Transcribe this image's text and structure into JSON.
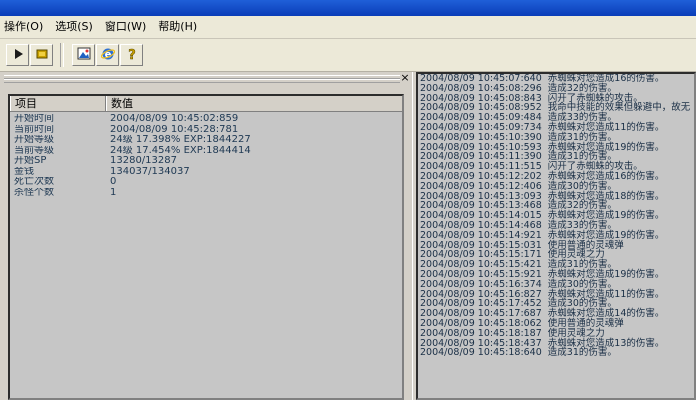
{
  "menu": [
    {
      "label": "操作(O)"
    },
    {
      "label": "选项(S)"
    },
    {
      "label": "窗口(W)"
    },
    {
      "label": "帮助(H)"
    }
  ],
  "toolbar_icons": [
    "play-icon",
    "stop-icon",
    "image-icon",
    "ie-icon",
    "help-icon"
  ],
  "panel": {
    "close_label": "×"
  },
  "stats": {
    "columns": [
      "项目",
      "数值"
    ],
    "rows": [
      {
        "name": "开始时间",
        "value": "2004/08/09 10:45:02:859"
      },
      {
        "name": "当前时间",
        "value": "2004/08/09 10:45:28:781"
      },
      {
        "name": "开始等级",
        "value": "24级 17.398% EXP:1844227"
      },
      {
        "name": "当前等级",
        "value": "24级 17.454% EXP:1844414"
      },
      {
        "name": "开始SP",
        "value": "13280/13287"
      },
      {
        "name": "金钱",
        "value": "134037/134037"
      },
      {
        "name": "死亡次数",
        "value": "0"
      },
      {
        "name": "杀怪个数",
        "value": "1"
      }
    ]
  },
  "log": [
    {
      "time": "2004/08/09 10:45:07:640",
      "msg": "赤蜘蛛对您造成16的伤害。"
    },
    {
      "time": "2004/08/09 10:45:08:296",
      "msg": "造成32的伤害。"
    },
    {
      "time": "2004/08/09 10:45:08:843",
      "msg": "闪开了赤蜘蛛的攻击。"
    },
    {
      "time": "2004/08/09 10:45:08:952",
      "msg": "我命中技能的效果但躲避中，故无"
    },
    {
      "time": "2004/08/09 10:45:09:484",
      "msg": "造成33的伤害。"
    },
    {
      "time": "2004/08/09 10:45:09:734",
      "msg": "赤蜘蛛对您造成11的伤害。"
    },
    {
      "time": "2004/08/09 10:45:10:390",
      "msg": "造成31的伤害。"
    },
    {
      "time": "2004/08/09 10:45:10:593",
      "msg": "赤蜘蛛对您造成19的伤害。"
    },
    {
      "time": "2004/08/09 10:45:11:390",
      "msg": "造成31的伤害。"
    },
    {
      "time": "2004/08/09 10:45:11:515",
      "msg": "闪开了赤蜘蛛的攻击。"
    },
    {
      "time": "2004/08/09 10:45:12:202",
      "msg": "赤蜘蛛对您造成16的伤害。"
    },
    {
      "time": "2004/08/09 10:45:12:406",
      "msg": "造成30的伤害。"
    },
    {
      "time": "2004/08/09 10:45:13:093",
      "msg": "赤蜘蛛对您造成18的伤害。"
    },
    {
      "time": "2004/08/09 10:45:13:468",
      "msg": "造成32的伤害。"
    },
    {
      "time": "2004/08/09 10:45:14:015",
      "msg": "赤蜘蛛对您造成19的伤害。"
    },
    {
      "time": "2004/08/09 10:45:14:468",
      "msg": "造成33的伤害。"
    },
    {
      "time": "2004/08/09 10:45:14:921",
      "msg": "赤蜘蛛对您造成19的伤害。"
    },
    {
      "time": "2004/08/09 10:45:15:031",
      "msg": "使用普通的灵魂弹"
    },
    {
      "time": "2004/08/09 10:45:15:171",
      "msg": "使用灵魂之力"
    },
    {
      "time": "2004/08/09 10:45:15:421",
      "msg": "造成31的伤害。"
    },
    {
      "time": "2004/08/09 10:45:15:921",
      "msg": "赤蜘蛛对您造成19的伤害。"
    },
    {
      "time": "2004/08/09 10:45:16:374",
      "msg": "造成30的伤害。"
    },
    {
      "time": "2004/08/09 10:45:16:827",
      "msg": "赤蜘蛛对您造成11的伤害。"
    },
    {
      "time": "2004/08/09 10:45:17:452",
      "msg": "造成30的伤害。"
    },
    {
      "time": "2004/08/09 10:45:17:687",
      "msg": "赤蜘蛛对您造成14的伤害。"
    },
    {
      "time": "2004/08/09 10:45:18:062",
      "msg": "使用普通的灵魂弹"
    },
    {
      "time": "2004/08/09 10:45:18:187",
      "msg": "使用灵魂之力"
    },
    {
      "time": "2004/08/09 10:45:18:437",
      "msg": "赤蜘蛛对您造成13的伤害。"
    },
    {
      "time": "2004/08/09 10:45:18:640",
      "msg": "造成31的伤害。"
    }
  ]
}
